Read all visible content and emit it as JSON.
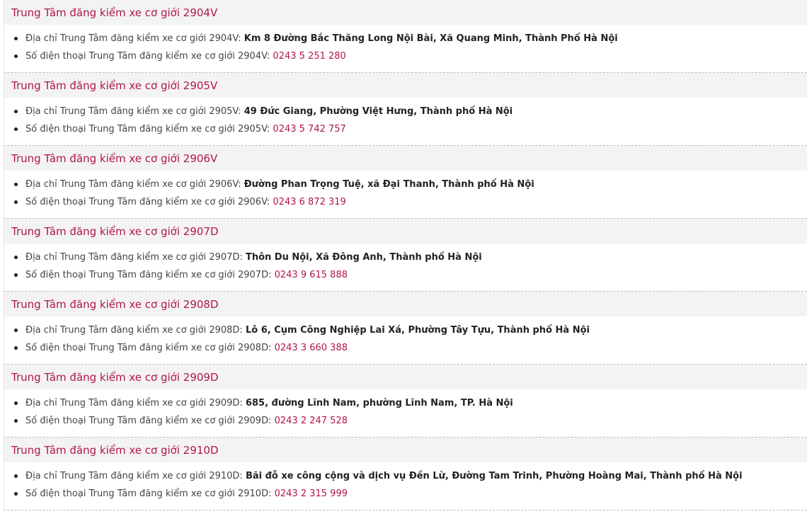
{
  "centers": [
    {
      "title": "Trung Tâm đăng kiểm xe cơ giới 2904V",
      "address_label": "Địa chỉ Trung Tâm đăng kiểm xe cơ giới 2904V: ",
      "address_value": "Km 8 Đường Bắc Thăng Long Nội Bài, Xã Quang Minh, Thành Phố Hà Nội",
      "phone_label": "Số điện thoại Trung Tâm đăng kiểm xe cơ giới 2904V: ",
      "phone_value": "0243 5 251 280"
    },
    {
      "title": "Trung Tâm đăng kiểm xe cơ giới 2905V",
      "address_label": "Địa chỉ Trung Tâm đăng kiểm xe cơ giới 2905V: ",
      "address_value": "49 Đức Giang, Phường Việt Hưng, Thành phố Hà Nội",
      "phone_label": "Số điện thoại Trung Tâm đăng kiểm xe cơ giới 2905V: ",
      "phone_value": "0243 5 742 757"
    },
    {
      "title": "Trung Tâm đăng kiểm xe cơ giới 2906V",
      "address_label": "Địa chỉ Trung Tâm đăng kiểm xe cơ giới 2906V: ",
      "address_value": "Đường Phan Trọng Tuệ, xã Đại Thanh, Thành phố Hà Nội",
      "phone_label": "Số điện thoại Trung Tâm đăng kiểm xe cơ giới 2906V: ",
      "phone_value": "0243 6 872 319"
    },
    {
      "title": "Trung Tâm đăng kiểm xe cơ giới 2907D",
      "address_label": "Địa chỉ Trung Tâm đăng kiểm xe cơ giới 2907D: ",
      "address_value": "Thôn Du Nội, Xã Đông Anh, Thành phố Hà Nội",
      "phone_label": "Số điện thoại Trung Tâm đăng kiểm xe cơ giới 2907D: ",
      "phone_value": "0243 9 615 888"
    },
    {
      "title": "Trung Tâm đăng kiểm xe cơ giới 2908D",
      "address_label": "Địa chỉ Trung Tâm đăng kiểm xe cơ giới 2908D: ",
      "address_value": "Lô 6, Cụm Công Nghiệp Lai Xá, Phường Tây Tựu, Thành phố Hà Nội",
      "phone_label": "Số điện thoại Trung Tâm đăng kiểm xe cơ giới 2908D: ",
      "phone_value": "0243 3 660 388"
    },
    {
      "title": "Trung Tâm đăng kiểm xe cơ giới 2909D",
      "address_label": "Địa chỉ Trung Tâm đăng kiểm xe cơ giới 2909D: ",
      "address_value": "685, đường Lĩnh Nam, phường Lĩnh Nam, TP. Hà Nội",
      "phone_label": "Số điện thoại Trung Tâm đăng kiểm xe cơ giới 2909D: ",
      "phone_value": "0243 2 247 528"
    },
    {
      "title": "Trung Tâm đăng kiểm xe cơ giới 2910D",
      "address_label": "Địa chỉ Trung Tâm đăng kiểm xe cơ giới 2910D: ",
      "address_value": "Bãi đỗ xe công cộng và dịch vụ Đền Lừ, Đường Tam Trinh, Phường Hoàng Mai, Thành phố Hà Nội",
      "phone_label": "Số điện thoại Trung Tâm đăng kiểm xe cơ giới 2910D: ",
      "phone_value": "0243 2 315 999"
    }
  ],
  "colors": {
    "title": "#b1164a",
    "phone": "#b1164a",
    "title_bg": "#f3f3f3",
    "address": "#222222"
  }
}
